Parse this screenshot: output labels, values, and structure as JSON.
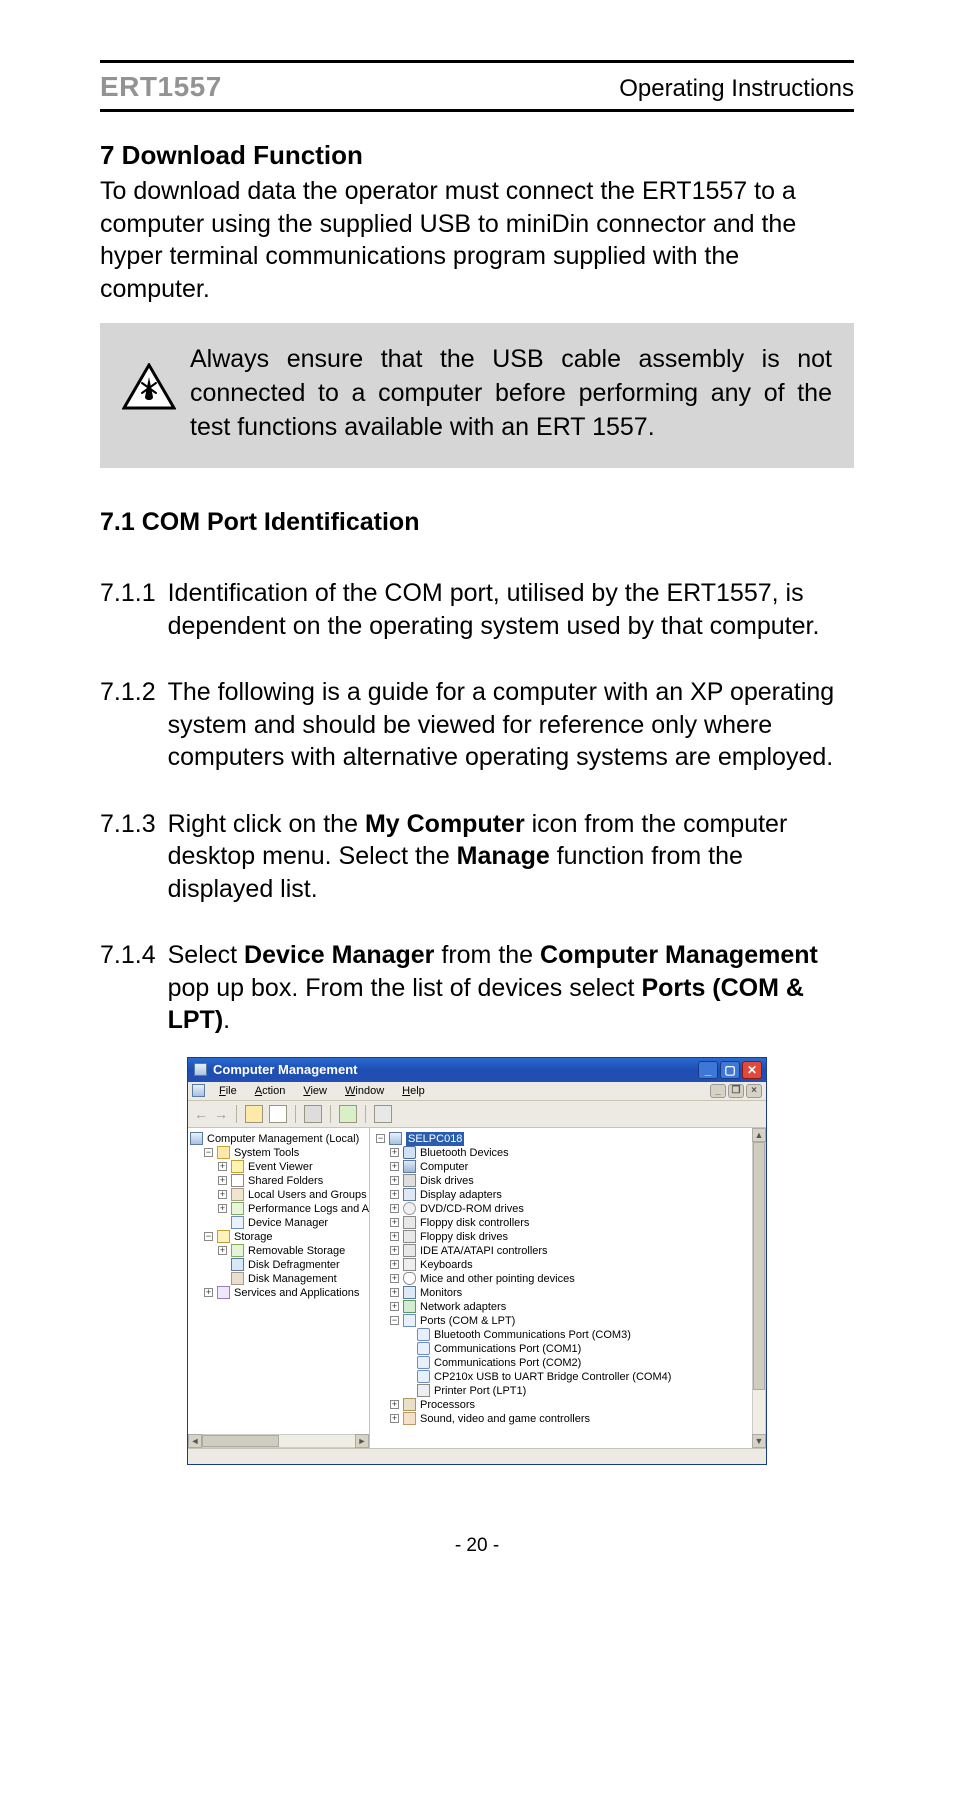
{
  "header": {
    "left": "ERT1557",
    "right": "Operating Instructions"
  },
  "section7": {
    "title": "7 Download Function",
    "intro": "To download data the operator must connect the ERT1557 to a computer using the supplied USB to miniDin connector and the hyper terminal communications program supplied with the computer."
  },
  "callout": {
    "text": "Always ensure that the USB cable assembly is not connected to a computer before performing any of the test functions available with an ERT 1557."
  },
  "section71": {
    "title": "7.1 COM Port Identification",
    "items": {
      "n1": "7.1.1",
      "t1": "Identification of the COM port, utilised by the ERT1557, is dependent on the operating system used by that computer.",
      "n2": "7.1.2",
      "t2": "The following is a guide for a computer with an XP operating system and should be viewed for reference only where computers with alternative operating systems are employed.",
      "n3": "7.1.3",
      "t3_pre": "Right click on the ",
      "t3_b1": "My Computer",
      "t3_mid": " icon from the computer desktop menu. Select the ",
      "t3_b2": "Manage",
      "t3_post": " function from the displayed list.",
      "n4": "7.1.4",
      "t4_pre": "Select ",
      "t4_b1": "Device Manager",
      "t4_mid1": " from the ",
      "t4_b2": "Computer Management",
      "t4_mid2": " pop up box. From the list of devices select ",
      "t4_b3": "Ports (COM & LPT)",
      "t4_post": "."
    }
  },
  "xp": {
    "title": "Computer Management",
    "menu": {
      "file": "File",
      "action": "Action",
      "view": "View",
      "window": "Window",
      "help": "Help"
    },
    "left_tree": {
      "root": "Computer Management (Local)",
      "systools": "System Tools",
      "event": "Event Viewer",
      "shared": "Shared Folders",
      "users": "Local Users and Groups",
      "perf": "Performance Logs and Alerts",
      "devmgr": "Device Manager",
      "storage": "Storage",
      "remov": "Removable Storage",
      "defrag": "Disk Defragmenter",
      "diskmgmt": "Disk Management",
      "services": "Services and Applications"
    },
    "right_tree": {
      "root": "SELPC018",
      "bt": "Bluetooth Devices",
      "computer": "Computer",
      "disk": "Disk drives",
      "display": "Display adapters",
      "dvd": "DVD/CD-ROM drives",
      "floppyctrl": "Floppy disk controllers",
      "floppy": "Floppy disk drives",
      "ide": "IDE ATA/ATAPI controllers",
      "kb": "Keyboards",
      "mouse": "Mice and other pointing devices",
      "monitors": "Monitors",
      "net": "Network adapters",
      "ports": "Ports (COM & LPT)",
      "p_bt": "Bluetooth Communications Port (COM3)",
      "p_c1": "Communications Port (COM1)",
      "p_c2": "Communications Port (COM2)",
      "p_cp": "CP210x USB to UART Bridge Controller (COM4)",
      "p_pr": "Printer Port (LPT1)",
      "proc": "Processors",
      "sound": "Sound, video and game controllers"
    }
  },
  "pageNumber": "- 20 -"
}
